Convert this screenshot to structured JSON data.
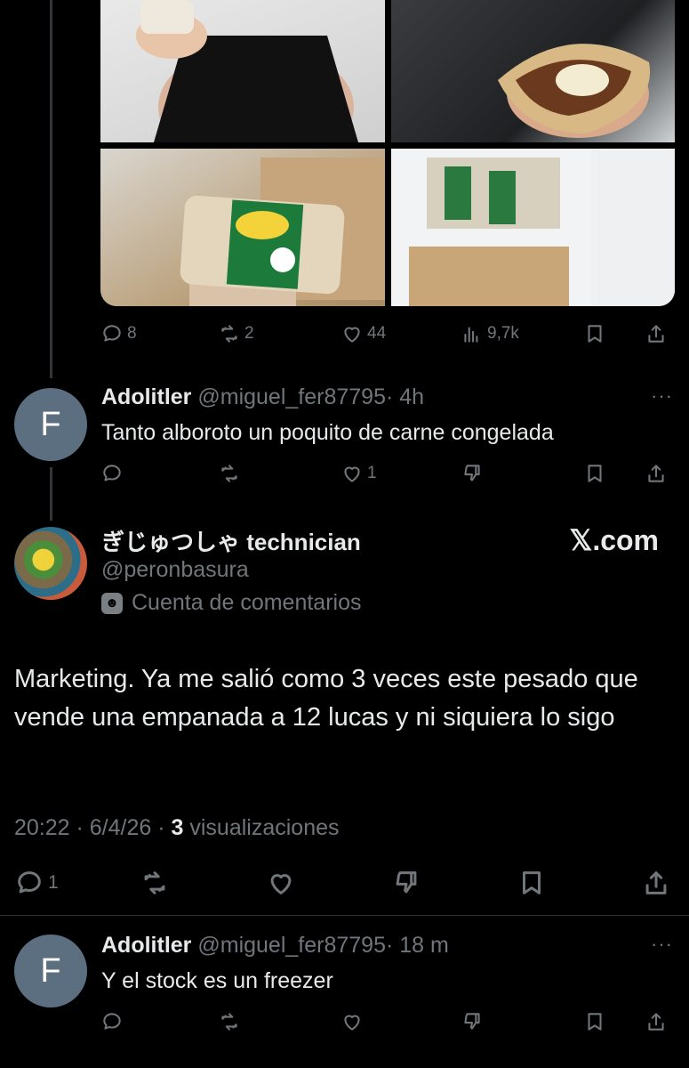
{
  "top_tweet": {
    "images": [
      "photo-person-holding-food",
      "photo-hand-holding-empanada",
      "photo-packaged-empanada-box",
      "photo-freezer-stock"
    ],
    "actions": {
      "replies": "8",
      "reposts": "2",
      "likes": "44",
      "views": "9,7k"
    }
  },
  "reply1": {
    "avatar_letter": "F",
    "name": "Adolitler",
    "handle": "@miguel_fer87795",
    "time": "· 4h",
    "more": "···",
    "text": "Tanto alboroto un poquito de carne congelada",
    "actions": {
      "likes": "1"
    }
  },
  "quoted": {
    "name": "ぎじゅつしゃ technician",
    "handle": "@peronbasura",
    "label": "Cuenta de comentarios",
    "watermark": "𝕏.com",
    "text": "Marketing. Ya me salió como 3 veces este pesado que vende una empanada a 12 lucas y ni siquiera lo sigo",
    "time": "20:22 · 6/4/26 ·",
    "views_count": "3",
    "views_label": "visualizaciones",
    "actions": {
      "replies": "1"
    }
  },
  "reply2": {
    "avatar_letter": "F",
    "name": "Adolitler",
    "handle": "@miguel_fer87795",
    "time": "· 18 m",
    "more": "···",
    "text": "Y el stock es un freezer"
  },
  "colors": {
    "background": "#000000",
    "text": "#e7e9ea",
    "muted": "#71767b",
    "divider": "#2f3336",
    "avatar": "#5b6f80"
  }
}
